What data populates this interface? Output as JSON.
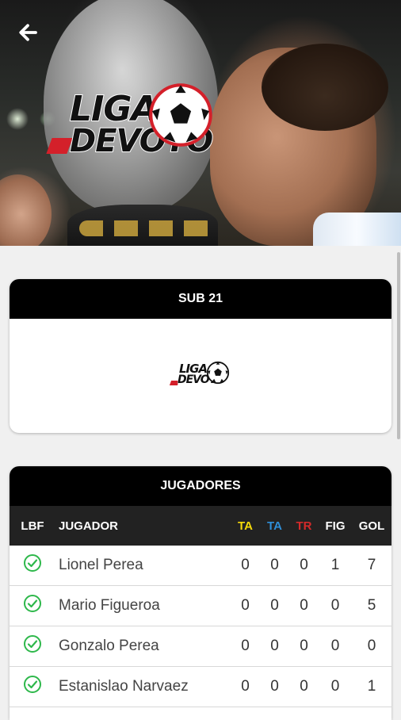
{
  "header": {
    "logo_line1": "LIGA",
    "logo_line2": "DEVOTO"
  },
  "category_card": {
    "title": "SUB 21",
    "logo_line1": "LIGA",
    "logo_line2": "DEVOTO"
  },
  "players_card": {
    "title": "JUGADORES",
    "columns": {
      "lbf": "LBF",
      "jugador": "JUGADOR",
      "ta_yellow": "TA",
      "ta_blue": "TA",
      "tr": "TR",
      "fig": "FIG",
      "gol": "GOL"
    },
    "rows": [
      {
        "name": "Lionel Perea",
        "ta_yellow": "0",
        "ta_blue": "0",
        "tr": "0",
        "fig": "1",
        "gol": "7"
      },
      {
        "name": "Mario Figueroa",
        "ta_yellow": "0",
        "ta_blue": "0",
        "tr": "0",
        "fig": "0",
        "gol": "5"
      },
      {
        "name": "Gonzalo Perea",
        "ta_yellow": "0",
        "ta_blue": "0",
        "tr": "0",
        "fig": "0",
        "gol": "0"
      },
      {
        "name": "Estanislao Narvaez",
        "ta_yellow": "0",
        "ta_blue": "0",
        "tr": "0",
        "fig": "0",
        "gol": "1"
      }
    ]
  },
  "colors": {
    "ta_yellow": "#f5d90a",
    "ta_blue": "#2f8fd8",
    "tr_red": "#d42a2a",
    "check_green": "#2eb84b",
    "accent_red": "#d4202a"
  },
  "icons": {
    "back": "arrow-left-icon",
    "check": "check-circle-icon",
    "ball": "soccer-ball-icon"
  }
}
